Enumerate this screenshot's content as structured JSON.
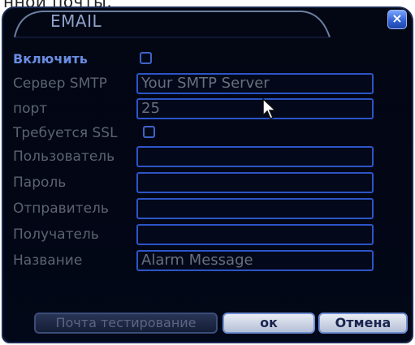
{
  "caption": "нной почты.",
  "dialog": {
    "title": "EMAIL",
    "close_glyph": "×"
  },
  "form": {
    "enable_label": "Включить",
    "smtp_label": "Сервер SMTP",
    "smtp_value": "Your SMTP Server",
    "port_label": "порт",
    "port_value": "25",
    "ssl_label": "Требуется SSL",
    "user_label": "Пользователь",
    "user_value": "",
    "password_label": "Пароль",
    "password_value": "",
    "sender_label": "Отправитель",
    "sender_value": "",
    "receiver_label": "Получатель",
    "receiver_value": "",
    "subject_label": "Название",
    "subject_value": "Alarm Message"
  },
  "buttons": {
    "test_label": "Почта тестирование",
    "ok_label": "ок",
    "cancel_label": "Отмена"
  },
  "colors": {
    "accent": "#2b55c7",
    "background": "#030818",
    "label": "#5c6470",
    "enabled_label": "#6a8ce0"
  }
}
